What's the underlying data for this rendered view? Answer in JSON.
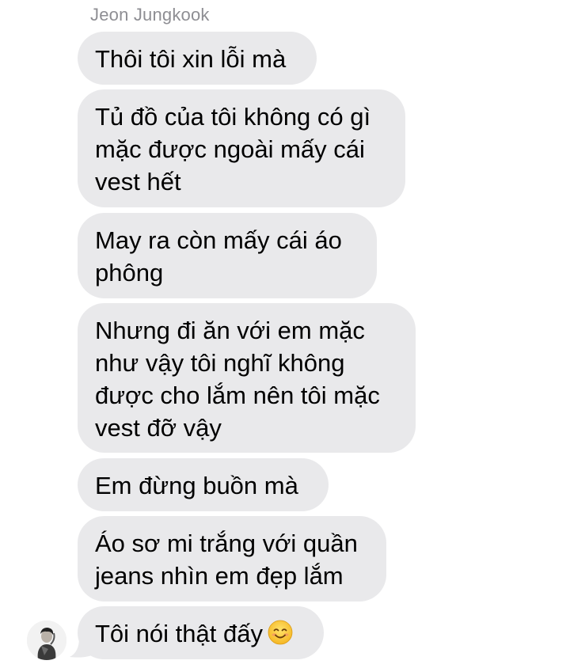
{
  "chat": {
    "sender_name": "Jeon Jungkook",
    "messages": [
      {
        "lines": [
          "Thôi tôi xin lỗi mà"
        ]
      },
      {
        "lines": [
          "Tủ đồ của tôi không có gì",
          "mặc được ngoài mấy cái",
          "vest hết"
        ]
      },
      {
        "lines": [
          "May ra còn mấy cái áo",
          "phông"
        ]
      },
      {
        "lines": [
          "Nhưng đi ăn với em mặc",
          "như vậy tôi nghĩ không",
          "được cho lắm nên tôi mặc",
          "vest đỡ vậy"
        ]
      },
      {
        "lines": [
          "Em đừng buồn mà"
        ]
      },
      {
        "lines": [
          "Áo sơ mi trắng với quần",
          "jeans nhìn em đẹp lắm"
        ]
      },
      {
        "lines": [
          "Tôi nói thật đấy"
        ],
        "emoji": "smiling-face-emoji"
      }
    ]
  },
  "colors": {
    "bubble_background": "#e9e9eb",
    "sender_name": "#8e8e93",
    "message_text": "#000000"
  }
}
